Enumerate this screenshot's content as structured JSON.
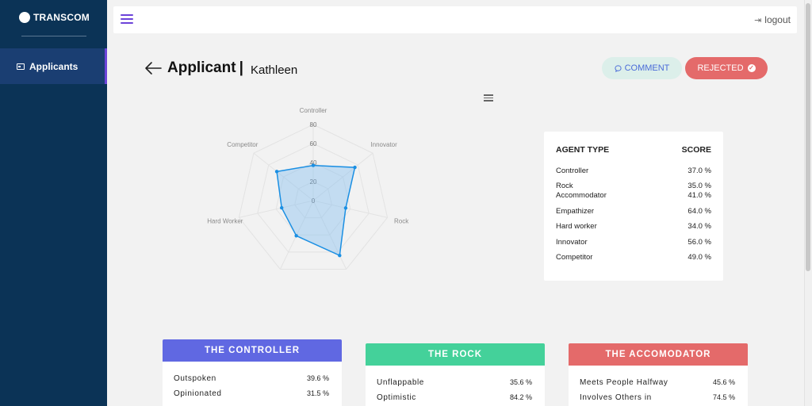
{
  "app": {
    "brand": "TRANSCOM"
  },
  "sidebar": {
    "items": [
      {
        "label": "Applicants"
      }
    ]
  },
  "topbar": {
    "logout_label": "logout"
  },
  "header": {
    "title": "Applicant",
    "separator": "|",
    "applicant_name": "Kathleen",
    "comment_label": "COMMENT",
    "rejected_label": "REJECTED"
  },
  "colors": {
    "sidebar": "#0b3356",
    "accent": "#6c43d9",
    "controller": "#6068e2",
    "rock": "#44d19a",
    "accomodator": "#e46a6a",
    "radar_line": "#1a8fe3"
  },
  "chart_data": {
    "type": "radar",
    "categories": [
      "Controller",
      "Innovator",
      "Rock",
      "Empathizer",
      "Accomodator",
      "Hard Worker",
      "Competitor"
    ],
    "values": [
      37,
      56,
      35,
      64,
      41,
      34,
      49
    ],
    "rlim": [
      0,
      80
    ],
    "ticks": [
      "0",
      "20",
      "40",
      "60",
      "80"
    ],
    "grid": true
  },
  "scores": {
    "col_type": "AGENT TYPE",
    "col_score": "SCORE",
    "rows": [
      {
        "label": "Controller",
        "value": "37.0 %"
      },
      {
        "label": "Rock",
        "value": "35.0 %"
      },
      {
        "label": "Accommodator",
        "value": "41.0 %"
      },
      {
        "label": "Empathizer",
        "value": "64.0 %"
      },
      {
        "label": "Hard worker",
        "value": "34.0 %"
      },
      {
        "label": "Innovator",
        "value": "56.0 %"
      },
      {
        "label": "Competitor",
        "value": "49.0 %"
      }
    ]
  },
  "traits": [
    {
      "title": "THE CONTROLLER",
      "items": [
        {
          "label": "Outspoken",
          "value": "39.6 %"
        },
        {
          "label": "Opinionated",
          "value": "31.5 %"
        }
      ]
    },
    {
      "title": "THE ROCK",
      "items": [
        {
          "label": "Unflappable",
          "value": "35.6 %"
        },
        {
          "label": "Optimistic",
          "value": "84.2 %"
        }
      ]
    },
    {
      "title": "THE ACCOMODATOR",
      "items": [
        {
          "label": "Meets People Halfway",
          "value": "45.6 %"
        },
        {
          "label": "Involves Others in",
          "value": "74.5 %"
        }
      ]
    }
  ]
}
